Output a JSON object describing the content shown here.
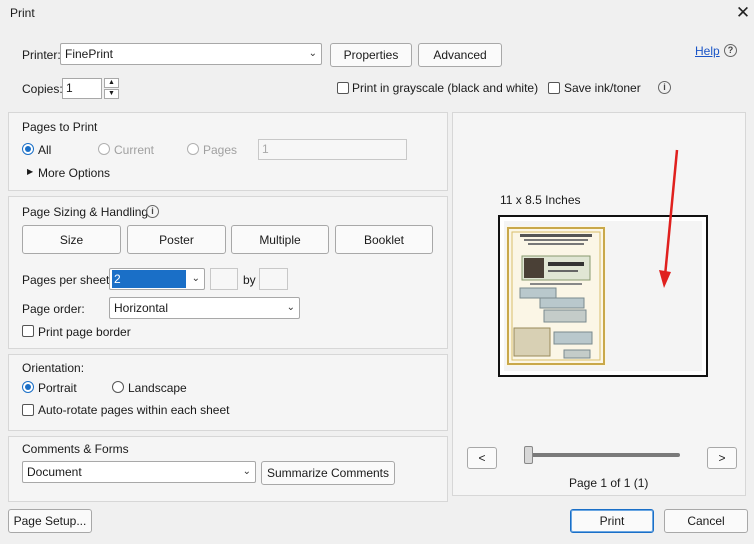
{
  "window": {
    "title": "Print",
    "close_glyph": "✕"
  },
  "printer": {
    "label": "Printer:",
    "value": "FinePrint",
    "properties_label": "Properties",
    "advanced_label": "Advanced",
    "help_label": "Help",
    "help_glyph": "?"
  },
  "copies": {
    "label": "Copies:",
    "value": "1",
    "grayscale_label": "Print in grayscale (black and white)",
    "save_ink_label": "Save ink/toner",
    "info_glyph": "i"
  },
  "pages_to_print": {
    "heading": "Pages to Print",
    "all_label": "All",
    "current_label": "Current",
    "pages_label": "Pages",
    "pages_value": "1",
    "more_options_label": "More Options"
  },
  "sizing": {
    "heading": "Page Sizing & Handling",
    "info_glyph": "i",
    "size_label": "Size",
    "poster_label": "Poster",
    "multiple_label": "Multiple",
    "booklet_label": "Booklet",
    "pages_per_sheet_label": "Pages per sheet:",
    "pages_per_sheet_value": "2",
    "by_label": "by",
    "page_order_label": "Page order:",
    "page_order_value": "Horizontal",
    "print_border_label": "Print page border"
  },
  "orientation": {
    "heading": "Orientation:",
    "portrait_label": "Portrait",
    "landscape_label": "Landscape",
    "auto_rotate_label": "Auto-rotate pages within each sheet"
  },
  "comments": {
    "heading": "Comments & Forms",
    "value": "Document",
    "summarize_label": "Summarize Comments"
  },
  "preview": {
    "size_label": "11 x 8.5 Inches",
    "prev_label": "<",
    "next_label": ">",
    "page_status": "Page 1 of 1 (1)",
    "slider_fraction": 0
  },
  "footer": {
    "page_setup_label": "Page Setup...",
    "print_label": "Print",
    "cancel_label": "Cancel"
  },
  "colors": {
    "accent": "#1a6fc7",
    "annotation_arrow": "#e0201e"
  }
}
